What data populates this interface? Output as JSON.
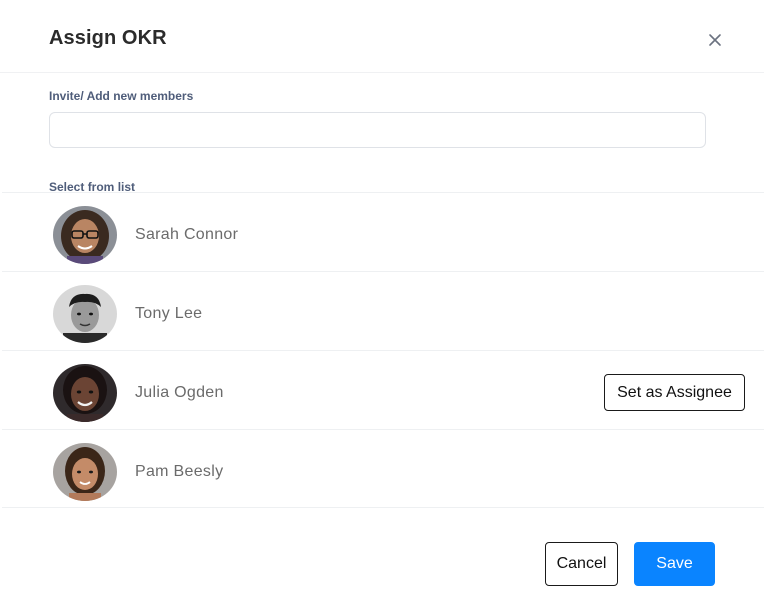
{
  "modal": {
    "title": "Assign OKR",
    "close_icon": "close-icon"
  },
  "invite": {
    "label": "Invite/ Add new members",
    "value": "",
    "placeholder": ""
  },
  "list": {
    "label": "Select from list",
    "members": [
      {
        "name": "Sarah Connor",
        "avatar": "avatar-photo"
      },
      {
        "name": "Tony Lee",
        "avatar": "avatar-photo"
      },
      {
        "name": "Julia Ogden",
        "avatar": "avatar-photo",
        "action_label": "Set as Assignee"
      },
      {
        "name": "Pam Beesly",
        "avatar": "avatar-photo"
      }
    ]
  },
  "footer": {
    "cancel_label": "Cancel",
    "save_label": "Save"
  },
  "colors": {
    "primary": "#0a84ff",
    "label": "#4f5d7a",
    "title": "#2b2b2b",
    "name": "#6b6b6b"
  }
}
